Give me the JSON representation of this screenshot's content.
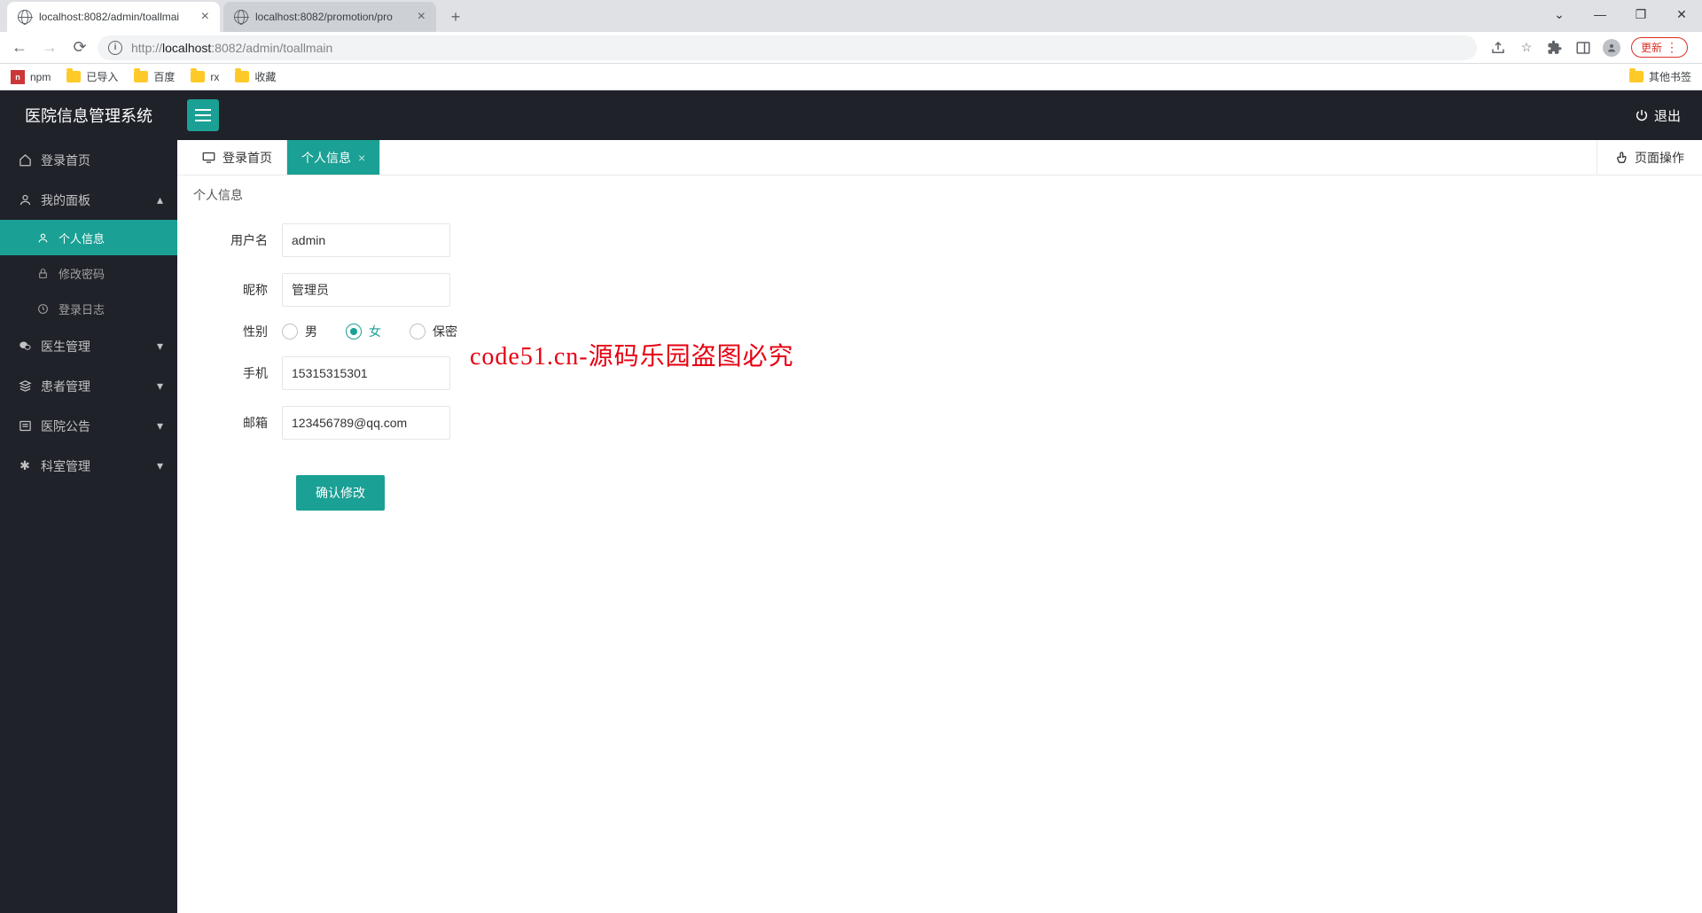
{
  "browser": {
    "tabs": [
      {
        "label": "localhost:8082/admin/toallmai"
      },
      {
        "label": "localhost:8082/promotion/pro"
      }
    ],
    "url_dim_prefix": "http://",
    "url_host": "localhost",
    "url_dim_port_path": ":8082/admin/toallmain",
    "update_label": "更新",
    "bookmarks": {
      "npm": "npm",
      "imported": "已导入",
      "baidu": "百度",
      "rx": "rx",
      "fav": "收藏",
      "other": "其他书签"
    }
  },
  "app": {
    "brand": "医院信息管理系统",
    "logout": "退出"
  },
  "sidebar": {
    "login_home": "登录首页",
    "my_panel": "我的面板",
    "profile": "个人信息",
    "change_pwd": "修改密码",
    "login_log": "登录日志",
    "doctor_mgmt": "医生管理",
    "patient_mgmt": "患者管理",
    "notice": "医院公告",
    "dept_mgmt": "科室管理"
  },
  "tabs": {
    "home": "登录首页",
    "profile": "个人信息",
    "page_ops": "页面操作"
  },
  "page": {
    "crumb": "个人信息",
    "labels": {
      "username": "用户名",
      "nickname": "昵称",
      "gender": "性别",
      "phone": "手机",
      "email": "邮箱"
    },
    "values": {
      "username": "admin",
      "nickname": "管理员",
      "phone": "15315315301",
      "email": "123456789@qq.com"
    },
    "gender_options": {
      "male": "男",
      "female": "女",
      "secret": "保密"
    },
    "gender_selected": "female",
    "submit": "确认修改",
    "watermark": "code51.cn-源码乐园盗图必究"
  }
}
